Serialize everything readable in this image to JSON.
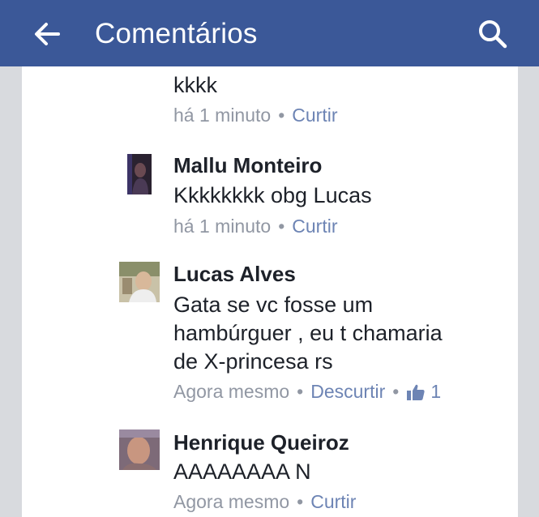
{
  "header": {
    "title": "Comentários",
    "back_icon": "arrow-left-icon",
    "search_icon": "search-icon",
    "color": "#3b5898"
  },
  "comments": [
    {
      "name": "",
      "text_lines": [
        "kkkk"
      ],
      "time": "há 1 minuto",
      "action": "Curtir"
    },
    {
      "name": "Mallu Monteiro",
      "text_lines": [
        "Kkkkkkkk obg Lucas"
      ],
      "time": "há 1 minuto",
      "action": "Curtir"
    },
    {
      "name": "Lucas Alves",
      "text_lines": [
        "Gata se vc fosse um",
        "hambúrguer , eu t chamaria",
        "de X-princesa rs"
      ],
      "time": "Agora mesmo",
      "action": "Descurtir",
      "likes": "1",
      "like_icon": "thumbs-up-icon"
    },
    {
      "name": "Henrique Queiroz",
      "text_lines": [
        "AAAAAAAA N"
      ],
      "time": "Agora mesmo",
      "action": "Curtir"
    }
  ]
}
